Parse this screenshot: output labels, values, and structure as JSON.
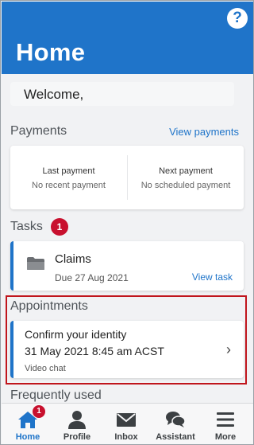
{
  "header": {
    "title": "Home",
    "help_icon": "question-circle-icon",
    "help_glyph": "?"
  },
  "welcome": {
    "text": "Welcome,"
  },
  "payments": {
    "label": "Payments",
    "link": "View payments",
    "last_title": "Last payment",
    "last_value": "No recent payment",
    "next_title": "Next payment",
    "next_value": "No scheduled payment"
  },
  "tasks": {
    "label": "Tasks",
    "badge_count": "1",
    "items": [
      {
        "icon": "folder-icon",
        "title": "Claims",
        "due": "Due 27 Aug 2021",
        "link": "View task"
      }
    ]
  },
  "appointments": {
    "label": "Appointments",
    "items": [
      {
        "title": "Confirm your identity",
        "datetime": "31 May 2021 8:45 am ACST",
        "type": "Video chat",
        "chevron": "›"
      }
    ]
  },
  "frequently_used": {
    "label": "Frequently used"
  },
  "bottom_nav": {
    "items": [
      {
        "label": "Home",
        "icon": "home-icon",
        "badge": "1",
        "active": true
      },
      {
        "label": "Profile",
        "icon": "person-icon"
      },
      {
        "label": "Inbox",
        "icon": "envelope-icon"
      },
      {
        "label": "Assistant",
        "icon": "chat-bubbles-icon"
      },
      {
        "label": "More",
        "icon": "menu-icon"
      }
    ]
  },
  "colors": {
    "brand_blue": "#1f74c9",
    "badge_red": "#c8102e",
    "highlight_red": "#c0151c"
  }
}
